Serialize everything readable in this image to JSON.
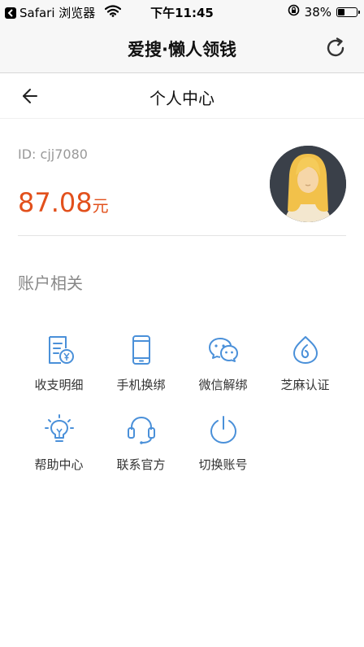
{
  "status_bar": {
    "carrier": "Safari 浏览器",
    "time": "下午11:45",
    "battery": "38%",
    "battery_level": 0.38
  },
  "browser": {
    "title": "爱搜·懒人领钱"
  },
  "page": {
    "title": "个人中心"
  },
  "profile": {
    "id_label": "ID: cjj7080",
    "balance_amount": "87.08",
    "balance_unit": "元"
  },
  "section": {
    "title": "账户相关"
  },
  "menu": [
    {
      "label": "收支明细",
      "icon": "receipt-yen-icon"
    },
    {
      "label": "手机换绑",
      "icon": "phone-icon"
    },
    {
      "label": "微信解绑",
      "icon": "wechat-icon"
    },
    {
      "label": "芝麻认证",
      "icon": "sesame-icon"
    },
    {
      "label": "帮助中心",
      "icon": "lightbulb-icon"
    },
    {
      "label": "联系官方",
      "icon": "headset-icon"
    },
    {
      "label": "切换账号",
      "icon": "power-icon"
    }
  ],
  "colors": {
    "accent": "#4a90d9",
    "balance": "#e2501c",
    "avatar_bg": "#3a4049",
    "avatar_hair": "#f2c14a"
  }
}
